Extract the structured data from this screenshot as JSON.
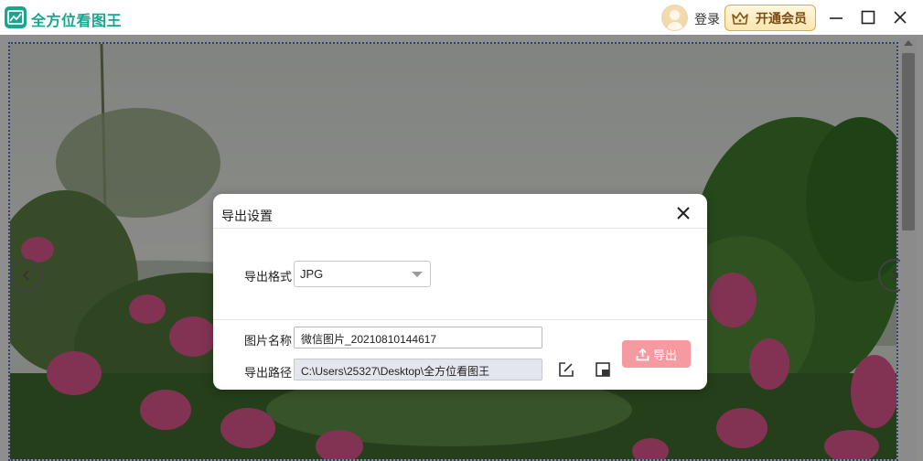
{
  "app": {
    "title": "全方位看图王",
    "accent_color": "#18a68f"
  },
  "header": {
    "login_label": "登录",
    "vip_label": "开通会员",
    "vip_icon": "crown-icon",
    "window_controls": [
      "minimize-icon",
      "maximize-icon",
      "close-icon"
    ]
  },
  "viewer": {
    "prev_icon": "chevron-left-icon",
    "next_icon": "chevron-right-icon"
  },
  "dialog": {
    "title": "导出设置",
    "format_label": "导出格式",
    "format_value": "JPG",
    "name_label": "图片名称",
    "name_value": "微信图片_20210810144617",
    "path_label": "导出路径",
    "path_value": "C:\\Users\\25327\\Desktop\\全方位看图王",
    "edit_path_icon": "edit-icon",
    "open_folder_icon": "folder-icon",
    "export_label": "导出",
    "export_icon": "upload-icon",
    "export_color": "#f49aa0"
  }
}
